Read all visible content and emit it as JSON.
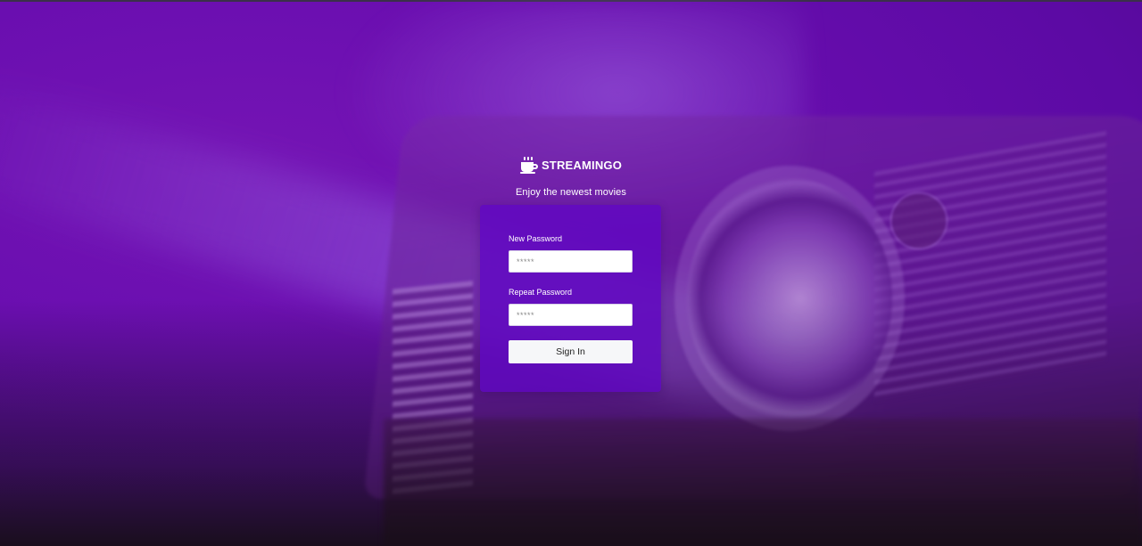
{
  "brand": {
    "logo_icon": "coffee-cup-icon",
    "name": "STREAMINGO",
    "tagline": "Enjoy the newest movies"
  },
  "form": {
    "new_password": {
      "label": "New Password",
      "placeholder": "*****",
      "value": ""
    },
    "repeat_password": {
      "label": "Repeat Password",
      "placeholder": "*****",
      "value": ""
    },
    "submit_label": "Sign In"
  },
  "colors": {
    "background": "#6a0eb0",
    "card": "#6006c4",
    "text": "#ffffff",
    "button": "#f6f7f9"
  }
}
